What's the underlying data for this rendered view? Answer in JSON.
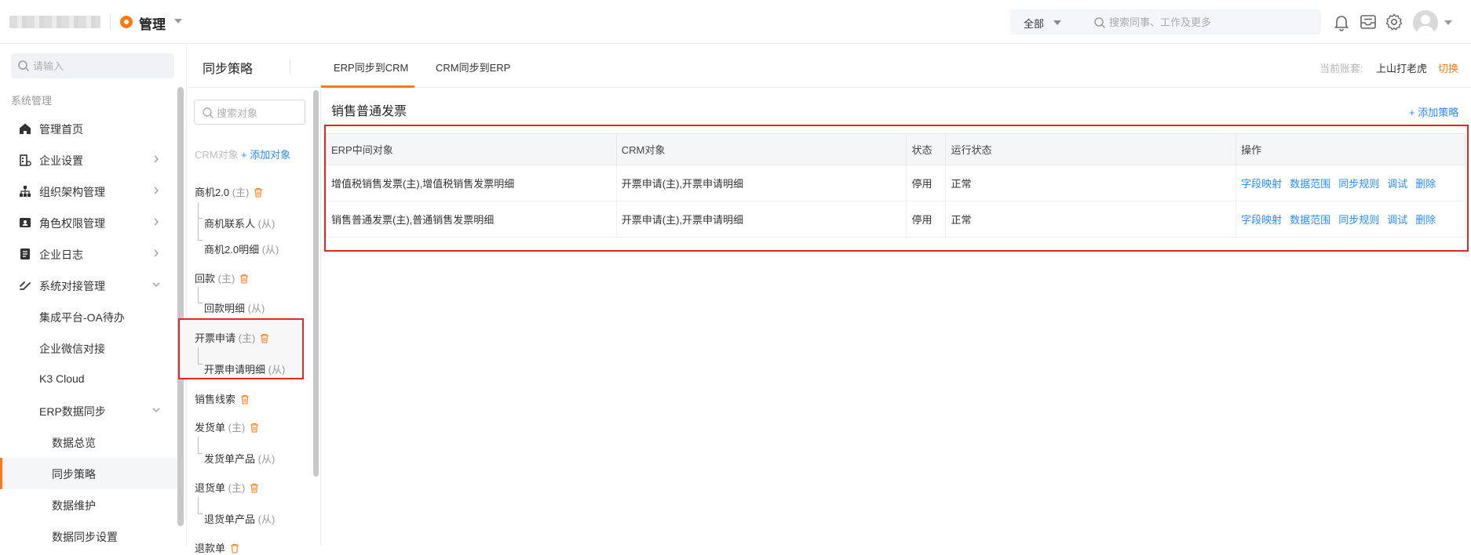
{
  "header": {
    "app_title": "管理",
    "scope_label": "全部",
    "search_placeholder": "搜索同事、工作及更多",
    "icons": [
      "bell-icon",
      "inbox-icon",
      "gear-icon",
      "avatar"
    ]
  },
  "sidebar": {
    "search_placeholder": "请输入",
    "section_title": "系统管理",
    "items": [
      {
        "label": "管理首页",
        "icon": "home-icon"
      },
      {
        "label": "企业设置",
        "icon": "building-icon"
      },
      {
        "label": "组织架构管理",
        "icon": "org-chart-icon"
      },
      {
        "label": "角色权限管理",
        "icon": "id-card-icon"
      },
      {
        "label": "企业日志",
        "icon": "log-icon"
      },
      {
        "label": "系统对接管理",
        "icon": "link-icon"
      },
      {
        "label": "集成平台-OA待办"
      },
      {
        "label": "企业微信对接"
      },
      {
        "label": "K3 Cloud"
      },
      {
        "label": "ERP数据同步"
      },
      {
        "label": "数据总览"
      },
      {
        "label": "同步策略"
      },
      {
        "label": "数据维护"
      },
      {
        "label": "数据同步设置"
      }
    ]
  },
  "subheader": {
    "title": "同步策略",
    "tabs": [
      {
        "label": "ERP同步到CRM",
        "active": true
      },
      {
        "label": "CRM同步到ERP",
        "active": false
      }
    ],
    "account_label": "当前账套:",
    "account_name": "上山打老虎",
    "switch_label": "切换"
  },
  "objects": {
    "search_placeholder": "搜索对象",
    "crm_label": "CRM对象",
    "add_label": "+ 添加对象",
    "main_tag": "(主)",
    "sub_tag": "(从)",
    "tree": [
      {
        "name": "商机2.0",
        "children": [
          "商机联系人",
          "商机2.0明细"
        ]
      },
      {
        "name": "回款",
        "children": [
          "回款明细"
        ]
      },
      {
        "name": "开票申请",
        "children": [
          "开票申请明细"
        ]
      },
      {
        "name": "销售线索",
        "children": []
      },
      {
        "name": "发货单",
        "children": [
          "发货单产品"
        ]
      },
      {
        "name": "退货单",
        "children": [
          "退货单产品"
        ]
      },
      {
        "name": "退款单",
        "children": []
      }
    ]
  },
  "main": {
    "title": "销售普通发票",
    "add_policy": "+ 添加策略",
    "columns": [
      "ERP中间对象",
      "CRM对象",
      "状态",
      "运行状态",
      "操作"
    ],
    "rows": [
      {
        "erp": "增值税销售发票(主),增值税销售发票明细",
        "crm": "开票申请(主),开票申请明细",
        "status": "停用",
        "run": "正常"
      },
      {
        "erp": "销售普通发票(主),普通销售发票明细",
        "crm": "开票申请(主),开票申请明细",
        "status": "停用",
        "run": "正常"
      }
    ],
    "actions": [
      "字段映射",
      "数据范围",
      "同步规则",
      "调试",
      "删除"
    ]
  },
  "colors": {
    "accent": "#ff7a14",
    "link": "#2c8cf0",
    "highlight": "#e3262a"
  }
}
